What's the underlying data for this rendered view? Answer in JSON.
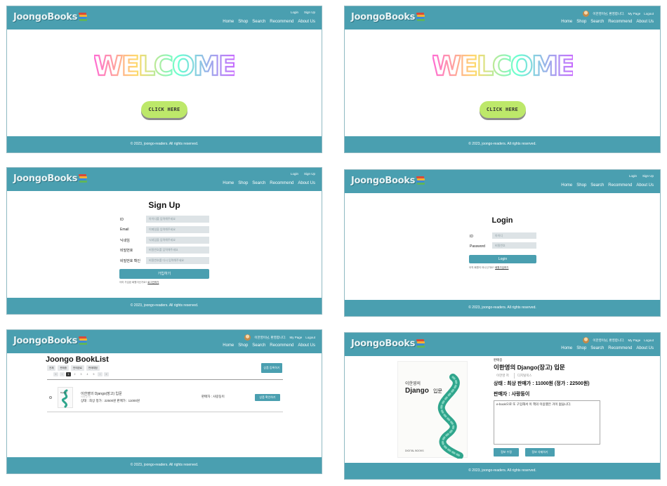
{
  "brand": {
    "logo": "JoongoBooks"
  },
  "nav": {
    "home": "Home",
    "shop": "Shop",
    "search": "Search",
    "recommend": "Recommend",
    "about": "About Us"
  },
  "auth": {
    "login": "Login",
    "signup": "Sign Up"
  },
  "user": {
    "greeting": "이한영이님, 환영합니다.",
    "mypage": "My Page",
    "logout": "Logout"
  },
  "footer": {
    "text": "© 2023, joongo-readers. All rights reserved."
  },
  "welcome": {
    "word": "WELCOME",
    "button": "CLICK HERE"
  },
  "signup": {
    "title": "Sign Up",
    "fields": [
      {
        "label": "ID",
        "placeholder": "아이디를 입력해주세요"
      },
      {
        "label": "Email",
        "placeholder": "이메일을 입력해주세요"
      },
      {
        "label": "닉네임",
        "placeholder": "닉네임을 입력해주세요"
      },
      {
        "label": "비밀번호",
        "placeholder": "비밀번호를 입력해주세요"
      },
      {
        "label": "비밀번호 확인",
        "placeholder": "비밀번호를 다시 입력해주세요"
      }
    ],
    "submit": "가입하기",
    "note": "이미 가입된 회원이신가요?",
    "note_link": "로그인하기"
  },
  "login": {
    "title": "Login",
    "fields": [
      {
        "label": "ID",
        "placeholder": "아이디"
      },
      {
        "label": "Password",
        "placeholder": "비밀번호"
      }
    ],
    "submit": "Login",
    "note": "아직 회원이 아니신가요?",
    "note_link": "회원가입하기"
  },
  "booklist": {
    "title": "Joongo BookList",
    "filters": [
      "전체",
      "판매중",
      "판매완료",
      "판매예정"
    ],
    "pages": [
      "«",
      "‹",
      "1",
      "2",
      "3",
      "4",
      "5",
      "›",
      "»"
    ],
    "current_page": "1",
    "register_button": "상품 등록하기",
    "item": {
      "name": "이한영의 Django(장고) 입문",
      "name_sub": "이한영 저",
      "meta": "상태 : 최상   정가 : 22500원  판매가 : 11000원",
      "seller": "판매자 : 사랑둥이",
      "detail_button": "상품 확인하기"
    }
  },
  "detail": {
    "tag": "판매중",
    "title": "이한영의 Django(장고) 입문",
    "tabs": [
      "이한영 저",
      "디지털북스"
    ],
    "state": "상태 : 최상     판매가 : 11000원 (정가 : 22500원)",
    "seller": "판매자 : 사랑둥이",
    "description": "e-book으로 또 구입해서 이 책의 이용했은 거이 없습니다.",
    "edit_button": "정보 수정",
    "delete_button": "정보 삭제하기",
    "cover": {
      "title_small": "이한영의",
      "title_big": "Django",
      "suffix": "입문",
      "publisher": "DIGITAL BOOKS"
    }
  },
  "colors": {
    "primary": "#4a9fb0",
    "button_green": "#bde86a"
  }
}
